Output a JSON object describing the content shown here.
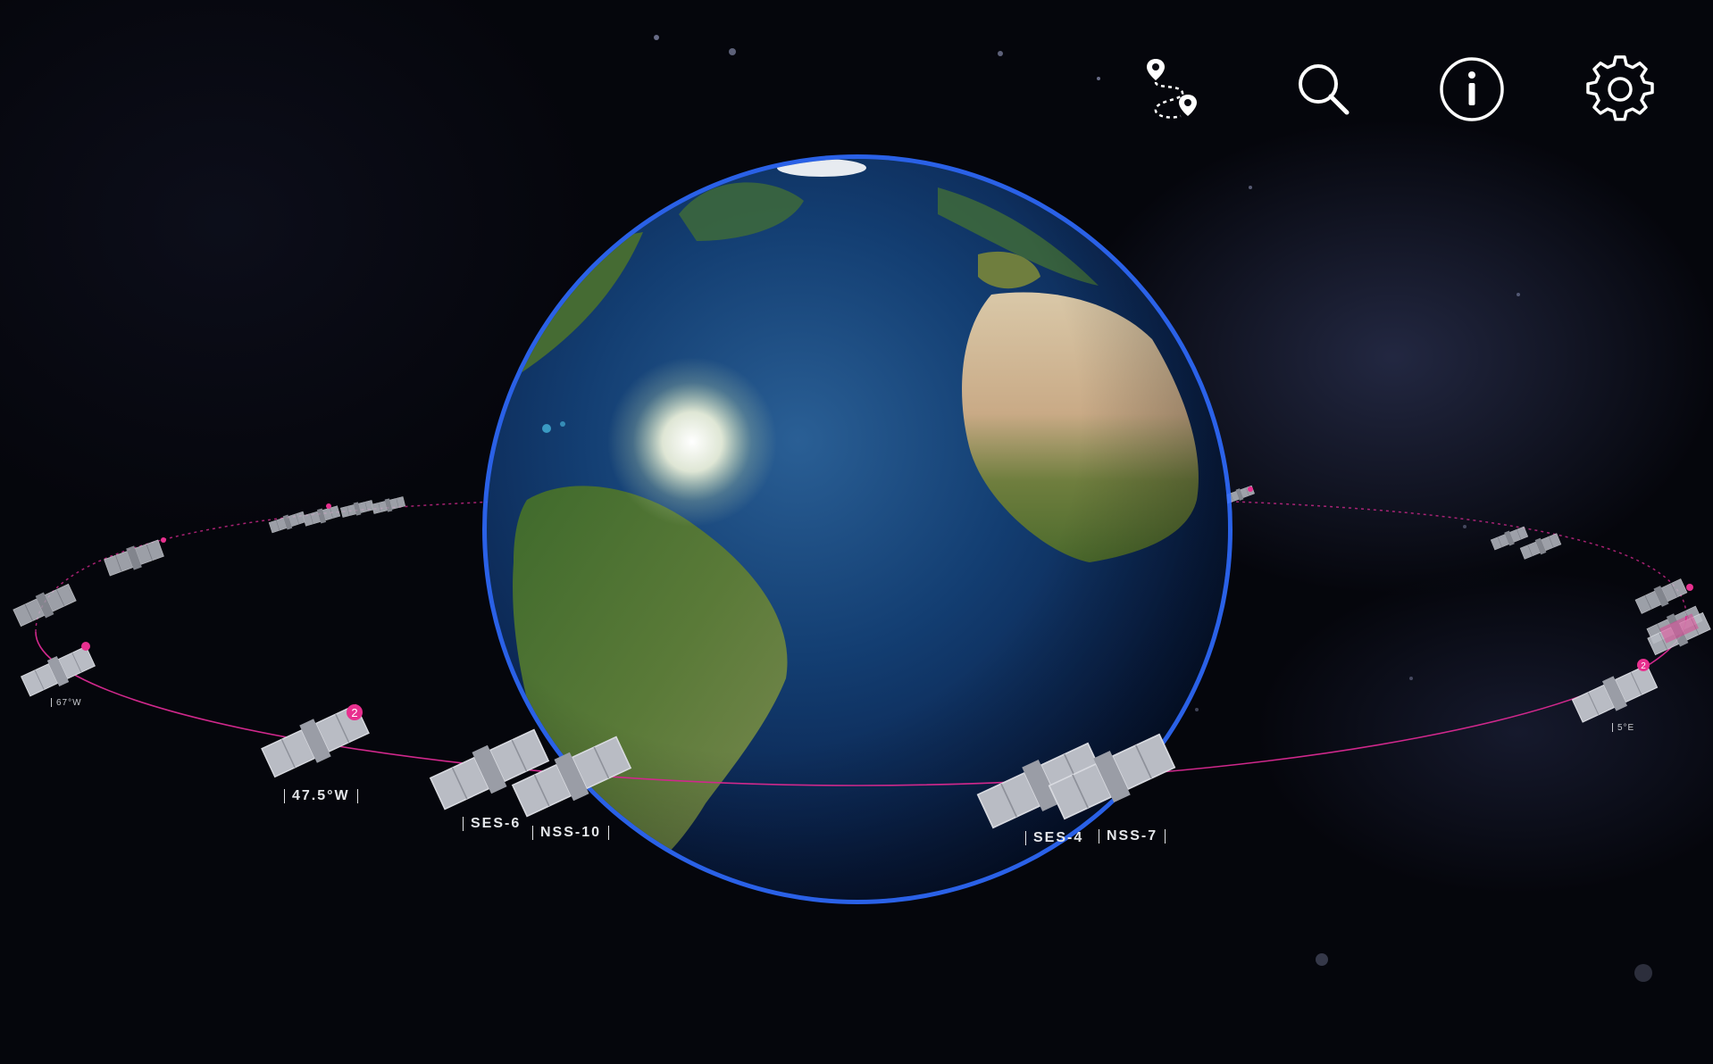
{
  "toolbar": {
    "route_icon": "route-pins-icon",
    "search_icon": "search-icon",
    "info_icon": "info-icon",
    "settings_icon": "gear-icon"
  },
  "satellite_labels": {
    "sat_67w": "67°W",
    "sat_47_5w": "47.5°W",
    "ses6": "SES-6",
    "nss10": "NSS-10",
    "ses4": "SES-4",
    "nss7": "NSS-7",
    "sat_5e": "5°E"
  },
  "cluster_badges": {
    "sat_47_5w": "2",
    "sat_5e": "2"
  },
  "colors": {
    "orbit": "#d0288c",
    "badge": "#e8308f",
    "satellite": "#b9bcc4",
    "atmosphere": "#2f6bff"
  }
}
